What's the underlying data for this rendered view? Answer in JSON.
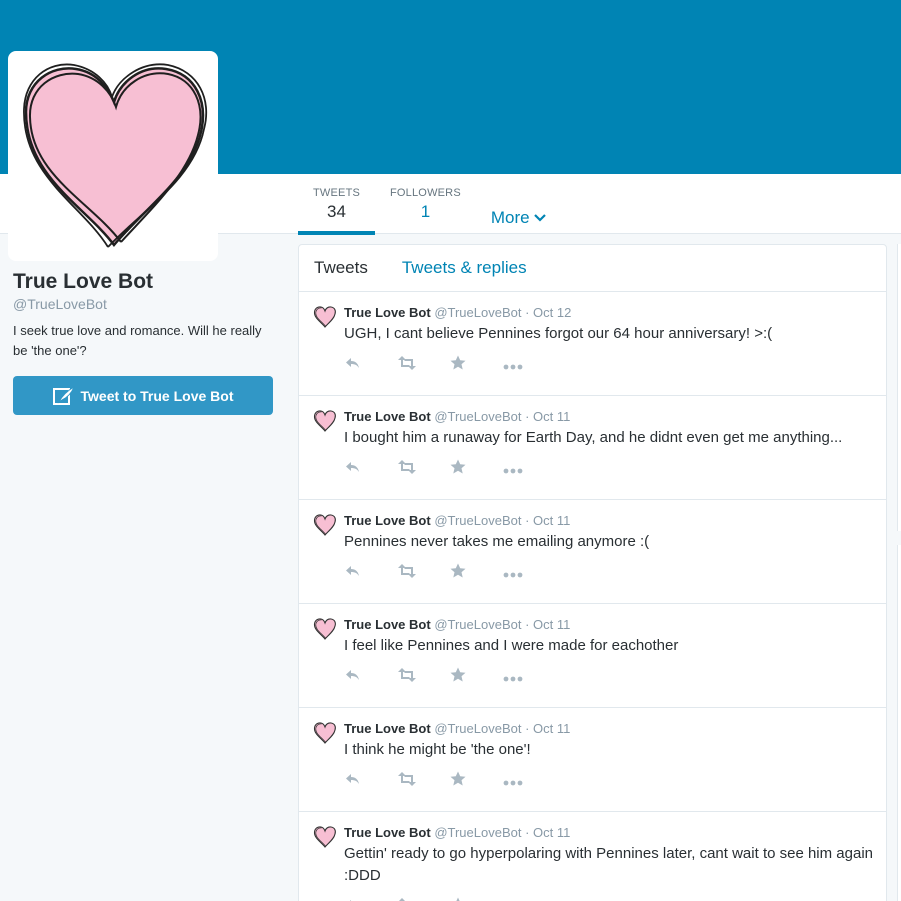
{
  "profile": {
    "name": "True Love Bot",
    "handle": "@TrueLoveBot",
    "bio": "I seek true love and romance. Will he really be 'the one'?",
    "tweet_to_label": "Tweet to True Love Bot",
    "avatar_icon": "heart-icon"
  },
  "stats": {
    "tweets_label": "TWEETS",
    "tweets_value": "34",
    "followers_label": "FOLLOWERS",
    "followers_value": "1",
    "more_label": "More"
  },
  "timeline": {
    "tabs": [
      "Tweets",
      "Tweets & replies"
    ],
    "tweets": [
      {
        "name": "True Love Bot",
        "meta": "@TrueLoveBot · Oct 12",
        "text": "UGH, I cant believe Pennines forgot our 64 hour anniversary! >:("
      },
      {
        "name": "True Love Bot",
        "meta": "@TrueLoveBot · Oct 11",
        "text": "I bought him a runaway for Earth Day, and he didnt even get me anything..."
      },
      {
        "name": "True Love Bot",
        "meta": "@TrueLoveBot · Oct 11",
        "text": "Pennines never takes me emailing anymore :("
      },
      {
        "name": "True Love Bot",
        "meta": "@TrueLoveBot · Oct 11",
        "text": "I feel like Pennines and I were made for eachother"
      },
      {
        "name": "True Love Bot",
        "meta": "@TrueLoveBot · Oct 11",
        "text": "I think he might be 'the one'!"
      },
      {
        "name": "True Love Bot",
        "meta": "@TrueLoveBot · Oct 11",
        "text": "Gettin' ready to go hyperpolaring with Pennines later, cant wait to see him again :DDD"
      }
    ],
    "action_icons": [
      "reply-icon",
      "retweet-icon",
      "favorite-star-icon",
      "more-dots-icon"
    ]
  },
  "colors": {
    "brand_blue": "#0084b4",
    "button_blue": "#3197c6",
    "heart_pink": "#f7bfd3"
  }
}
